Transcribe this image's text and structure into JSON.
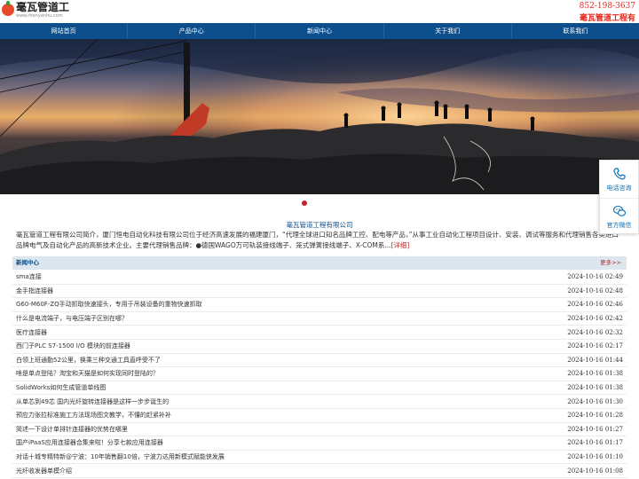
{
  "header": {
    "logo_name": "毫瓦管道工程",
    "logo_url": "www.rhenyanhu.com",
    "phone": "852-198-3637",
    "company": "毫瓦管道工程有"
  },
  "nav": [
    "网站首页",
    "产品中心",
    "新闻中心",
    "关于我们",
    "联系我们"
  ],
  "intro": {
    "title": "毫瓦管道工程有限公司",
    "text": "毫瓦管道工程有限公司简介，厦门恒电自动化科技有限公司位于经济高速发展的福建厦门，“代理全球进口知名品牌工控、配电等产品，”从事工业自动化工程项目设计、安装、调试等服务和代理销售各类进口品牌电气及自动化产品的高新技术企业。主要代理销售品牌：●德国WAGO万可轨装接线端子、笼式弹簧接线端子、X-COM系...",
    "more": "[详细]"
  },
  "news": {
    "title": "新闻中心",
    "more": "更多>>",
    "items": [
      {
        "title": "sma连接",
        "date": "2024-10-16 02:49"
      },
      {
        "title": "金手指连接器",
        "date": "2024-10-16 02:48"
      },
      {
        "title": "G60-M60F-ZQ手动抓取快速接头，专用于吊装设备的重物快速抓取",
        "date": "2024-10-16 02:46"
      },
      {
        "title": "什么是电流端子，与电压端子区别在哪？",
        "date": "2024-10-16 02:42"
      },
      {
        "title": "医疗连接器",
        "date": "2024-10-16 02:32"
      },
      {
        "title": "西门子PLC S7-1500 I/O 模块的前连接器",
        "date": "2024-10-16 02:17"
      },
      {
        "title": "白领上班通勤52公里，换乘三种交通工具直呼受不了",
        "date": "2024-10-16 01:44"
      },
      {
        "title": "啥是单点登陆？淘宝和天猫是如何实现同时登陆的？",
        "date": "2024-10-16 01:38"
      },
      {
        "title": "SolidWorks如何生成管道单线图",
        "date": "2024-10-16 01:38"
      },
      {
        "title": "从单芯到49芯 国内光纤旋转连接器是这样一步步诞生的",
        "date": "2024-10-16 01:30"
      },
      {
        "title": "预应力张拉标准施工方法现场图文教学，不懂的赶紧补补",
        "date": "2024-10-16 01:28"
      },
      {
        "title": "简述一下设计单排针连接器的优势在哪里",
        "date": "2024-10-16 01:27"
      },
      {
        "title": "国产iPaaS应用连接器合集来啦！分享七款应用连接器",
        "date": "2024-10-16 01:17"
      },
      {
        "title": "对话十城专精特新@宁波：10年销售翻10倍，宁波力达用新模式赋能侠发展",
        "date": "2024-10-16 01:10"
      },
      {
        "title": "光纤收发器单模介绍",
        "date": "2024-10-16 01:08"
      }
    ]
  },
  "side": {
    "phone_label": "电话咨询",
    "wechat_label": "官方微信"
  },
  "colors": {
    "nav_bg": "#0d4f8d",
    "accent_red": "#e8251a",
    "news_bar": "#dbe6ee"
  },
  "icons": [
    "phone-icon",
    "wechat-icon",
    "logo-icon"
  ]
}
